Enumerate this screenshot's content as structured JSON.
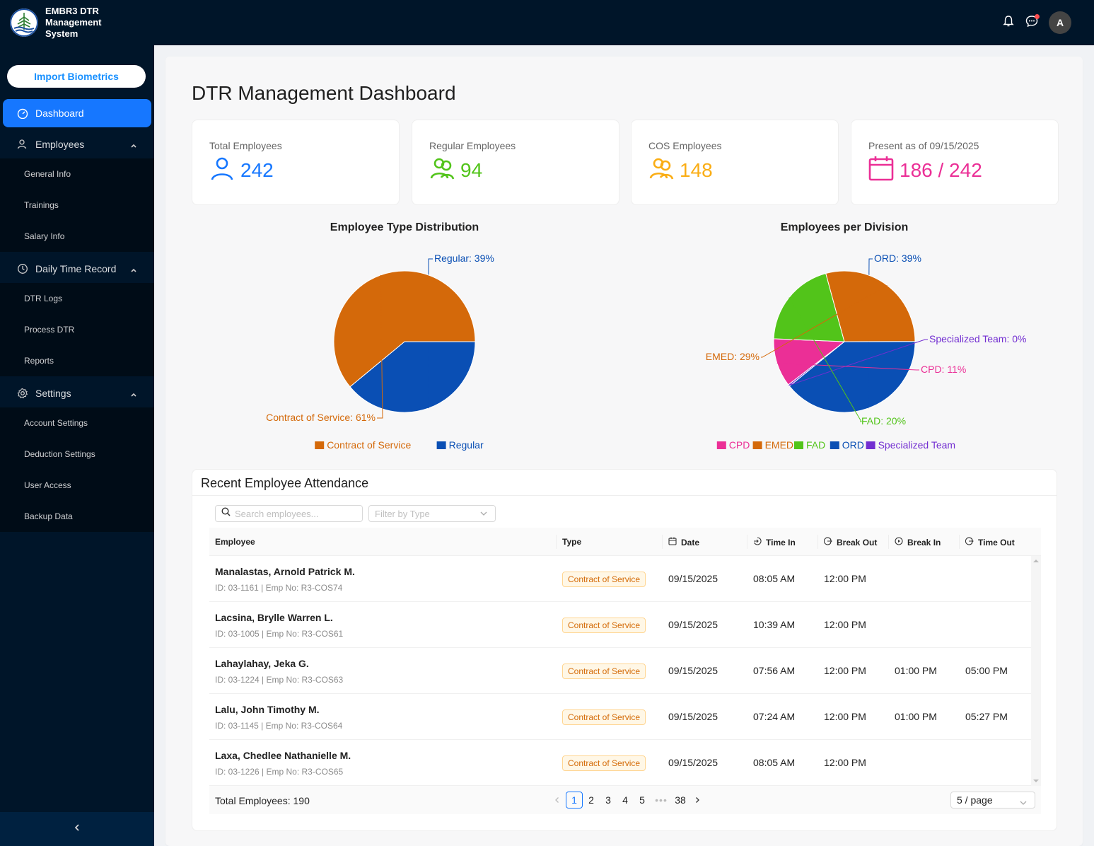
{
  "app": {
    "title": "EMBR3 DTR Management System",
    "import_button": "Import Biometrics"
  },
  "sidebar": {
    "dashboard": "Dashboard",
    "employees": {
      "label": "Employees",
      "items": [
        "General Info",
        "Trainings",
        "Salary Info"
      ]
    },
    "dtr": {
      "label": "Daily Time Record",
      "items": [
        "DTR Logs",
        "Process DTR",
        "Reports"
      ]
    },
    "settings": {
      "label": "Settings",
      "items": [
        "Account Settings",
        "Deduction Settings",
        "User Access",
        "Backup Data"
      ]
    }
  },
  "header": {
    "avatar_initial": "A",
    "icons": [
      "bell-icon",
      "message-icon"
    ]
  },
  "page": {
    "title": "DTR Management Dashboard"
  },
  "stats": [
    {
      "label": "Total Employees",
      "value": "242",
      "icon": "user-icon",
      "color": "#1677ff"
    },
    {
      "label": "Regular Employees",
      "value": "94",
      "icon": "team-icon",
      "color": "#52c41a"
    },
    {
      "label": "COS Employees",
      "value": "148",
      "icon": "team-icon",
      "color": "#faad14"
    },
    {
      "label": "Present as of 09/15/2025",
      "value": "186 / 242",
      "icon": "calendar-icon",
      "color": "#eb2f96"
    }
  ],
  "chart_data": [
    {
      "type": "pie",
      "title": "Employee Type Distribution",
      "slices": [
        {
          "name": "Regular",
          "value": 39,
          "color": "#0a4fb4",
          "label": "Regular: 39%"
        },
        {
          "name": "Contract of Service",
          "value": 61,
          "color": "#d4690a",
          "label": "Contract of Service: 61%"
        }
      ],
      "legend": [
        "Contract of Service",
        "Regular"
      ],
      "legend_position": "bottom"
    },
    {
      "type": "pie",
      "title": "Employees per Division",
      "slices": [
        {
          "name": "ORD",
          "value": 39,
          "color": "#0a4fb4",
          "label": "ORD: 39%"
        },
        {
          "name": "Specialized Team",
          "value": 0.4,
          "color": "#722ed1",
          "label": "Specialized Team: 0%"
        },
        {
          "name": "CPD",
          "value": 11,
          "color": "#eb2f96",
          "label": "CPD: 11%"
        },
        {
          "name": "FAD",
          "value": 20,
          "color": "#52c41a",
          "label": "FAD: 20%"
        },
        {
          "name": "EMED",
          "value": 29,
          "color": "#d4690a",
          "label": "EMED: 29%"
        }
      ],
      "legend": [
        "CPD",
        "EMED",
        "FAD",
        "ORD",
        "Specialized Team"
      ],
      "legend_position": "bottom"
    }
  ],
  "attendance": {
    "title": "Recent Employee Attendance",
    "search_placeholder": "Search employees...",
    "filter_placeholder": "Filter by Type",
    "columns": [
      "Employee",
      "Type",
      "Date",
      "Time In",
      "Break Out",
      "Break In",
      "Time Out"
    ],
    "rows": [
      {
        "name": "Manalastas, Arnold Patrick M.",
        "meta": "ID: 03-1161 | Emp No: R3-COS74",
        "type": "Contract of Service",
        "date": "09/15/2025",
        "time_in": "08:05 AM",
        "break_out": "12:00 PM",
        "break_in": "",
        "time_out": ""
      },
      {
        "name": "Lacsina, Brylle Warren L.",
        "meta": "ID: 03-1005 | Emp No: R3-COS61",
        "type": "Contract of Service",
        "date": "09/15/2025",
        "time_in": "10:39 AM",
        "break_out": "12:00 PM",
        "break_in": "",
        "time_out": ""
      },
      {
        "name": "Lahaylahay, Jeka G.",
        "meta": "ID: 03-1224 | Emp No: R3-COS63",
        "type": "Contract of Service",
        "date": "09/15/2025",
        "time_in": "07:56 AM",
        "break_out": "12:00 PM",
        "break_in": "01:00 PM",
        "time_out": "05:00 PM"
      },
      {
        "name": "Lalu, John Timothy M.",
        "meta": "ID: 03-1145 | Emp No: R3-COS64",
        "type": "Contract of Service",
        "date": "09/15/2025",
        "time_in": "07:24 AM",
        "break_out": "12:00 PM",
        "break_in": "01:00 PM",
        "time_out": "05:27 PM"
      },
      {
        "name": "Laxa, Chedlee Nathanielle M.",
        "meta": "ID: 03-1226 | Emp No: R3-COS65",
        "type": "Contract of Service",
        "date": "09/15/2025",
        "time_in": "08:05 AM",
        "break_out": "12:00 PM",
        "break_in": "",
        "time_out": ""
      }
    ],
    "total_text": "Total Employees: 190",
    "pages": [
      "1",
      "2",
      "3",
      "4",
      "5",
      "•••",
      "38"
    ],
    "active_page": "1",
    "page_size": "5 / page"
  }
}
